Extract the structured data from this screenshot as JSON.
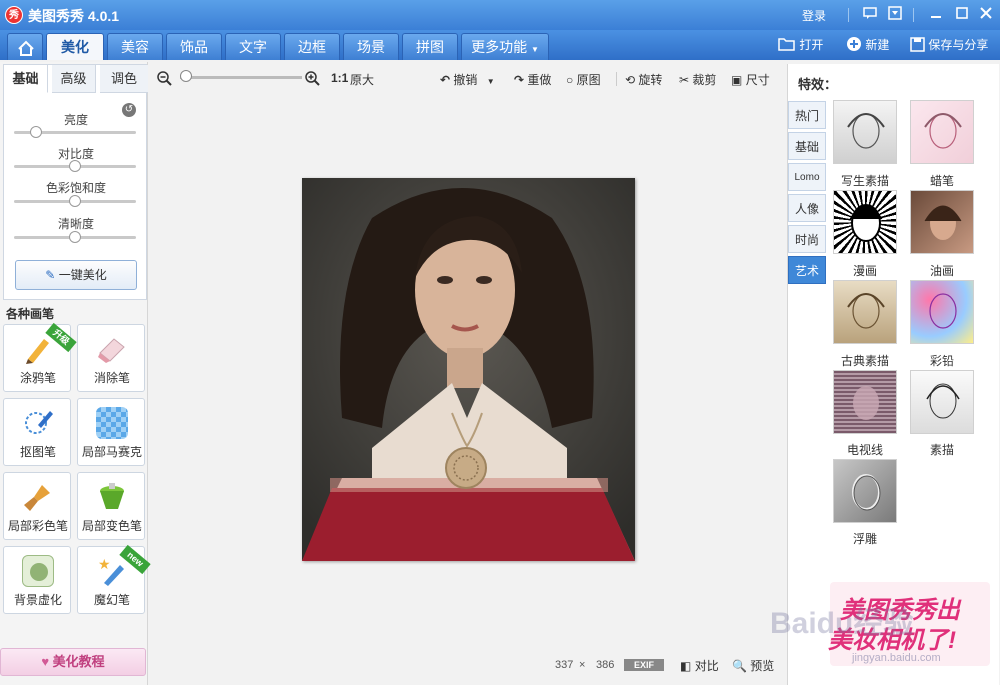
{
  "window": {
    "title": "美图秀秀 4.0.1",
    "logo_text": "秀",
    "login": "登录"
  },
  "nav": {
    "tabs": [
      "美化",
      "美容",
      "饰品",
      "文字",
      "边框",
      "场景",
      "拼图",
      "更多功能"
    ],
    "more_arrow": "▼",
    "open": "打开",
    "new": "新建",
    "save_share": "保存与分享"
  },
  "left": {
    "subtabs": [
      "基础",
      "高级",
      "调色"
    ],
    "sliders": [
      {
        "label": "亮度",
        "value": 0.18
      },
      {
        "label": "对比度",
        "value": 0.5
      },
      {
        "label": "色彩饱和度",
        "value": 0.5
      },
      {
        "label": "清晰度",
        "value": 0.5
      }
    ],
    "one_key": "一键美化",
    "brushes_heading": "各种画笔",
    "tools": [
      {
        "label": "涂鸦笔",
        "badge": "升级"
      },
      {
        "label": "消除笔",
        "badge": ""
      },
      {
        "label": "抠图笔",
        "badge": ""
      },
      {
        "label": "局部马赛克",
        "badge": ""
      },
      {
        "label": "局部彩色笔",
        "badge": ""
      },
      {
        "label": "局部变色笔",
        "badge": ""
      },
      {
        "label": "背景虚化",
        "badge": ""
      },
      {
        "label": "魔幻笔",
        "badge": "new"
      }
    ],
    "tutorial": "美化教程"
  },
  "toolbar": {
    "zoom_level": 0.05,
    "ratio": "1:1",
    "original_size": "原大",
    "undo": "撤销",
    "redo": "重做",
    "original": "原图",
    "rotate": "旋转",
    "crop": "裁剪",
    "size": "尺寸"
  },
  "status": {
    "width": "337",
    "times": "×",
    "height": "386",
    "exif": "EXIF",
    "compare": "对比",
    "preview": "预览"
  },
  "effects": {
    "title": "特效：",
    "categories": [
      "热门",
      "基础",
      "Lomo",
      "人像",
      "时尚",
      "艺术"
    ],
    "active_category": "艺术",
    "items": [
      "写生素描",
      "蜡笔",
      "漫画",
      "油画",
      "古典素描",
      "彩铅",
      "电视线",
      "素描",
      "浮雕"
    ]
  },
  "ad": {
    "line1": "美图秀秀出",
    "line2": "美妆相机了!"
  },
  "watermark": {
    "brand": "Baidu经验",
    "url": "jingyan.baidu.com"
  },
  "colors": {
    "accent": "#3b7fd6",
    "ad_pink": "#e0307a"
  }
}
